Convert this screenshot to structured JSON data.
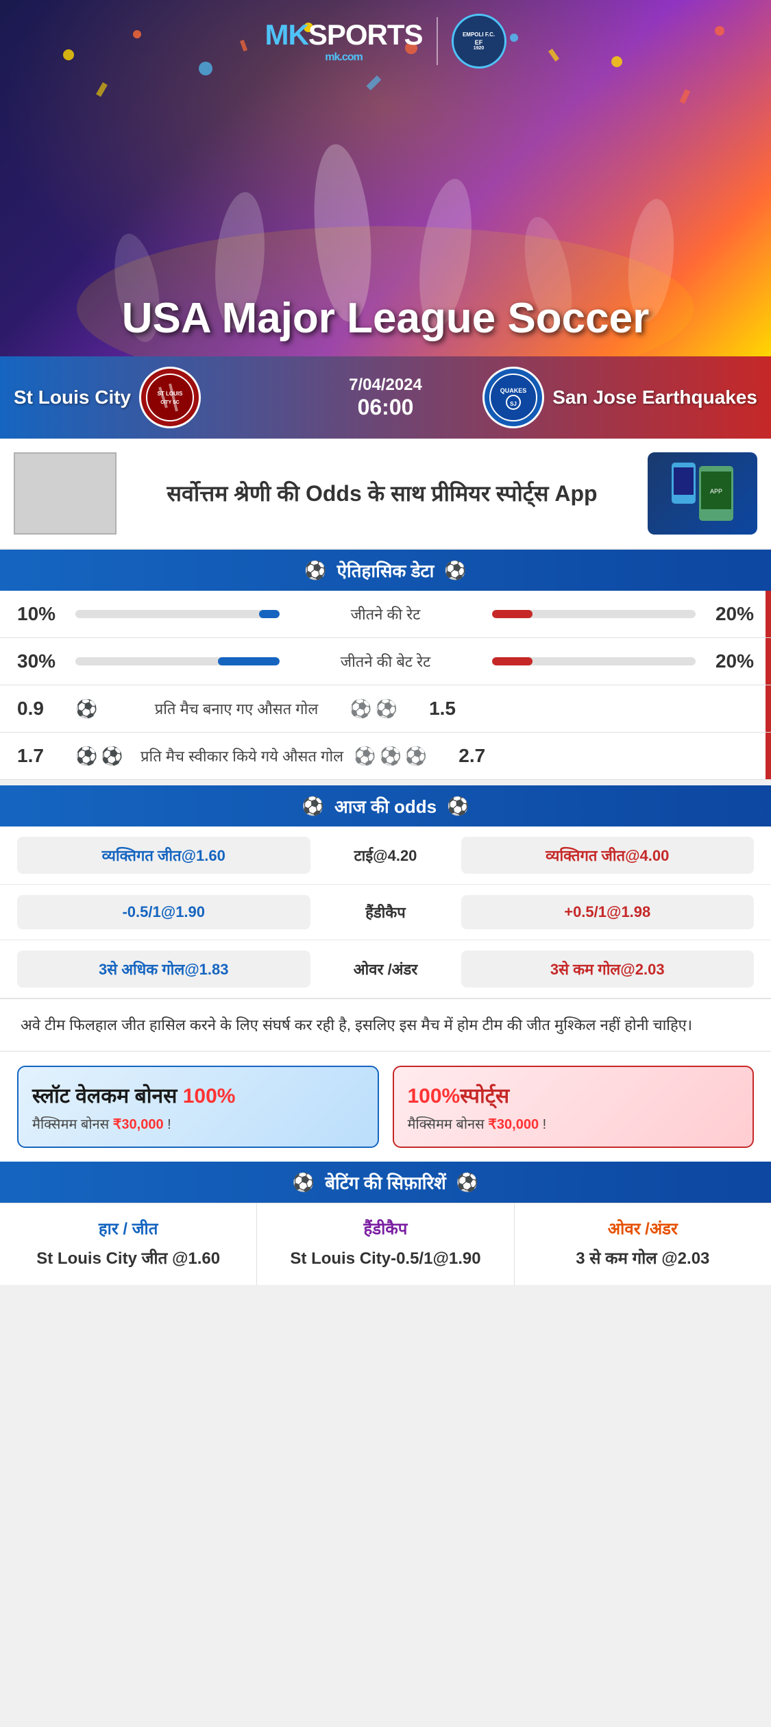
{
  "brand": {
    "name_mk": "MK",
    "name_sports": "SPORTS",
    "tagline": "mk.com",
    "partner_badge": "EMPOLI F.C.",
    "partner_year": "1920"
  },
  "hero": {
    "title": "USA Major League Soccer"
  },
  "match": {
    "home_team": "St Louis City",
    "away_team": "San Jose Earthquakes",
    "away_team_short": "QUAKES",
    "date": "7/04/2024",
    "time": "06:00"
  },
  "ad": {
    "text": "सर्वोत्तम श्रेणी की Odds के साथ प्रीमियर स्पोर्ट्स App"
  },
  "historical": {
    "section_title": "ऐतिहासिक डेटा",
    "stats": [
      {
        "label": "जीतने की रेट",
        "left_value": "10%",
        "right_value": "20%",
        "left_pct": 10,
        "right_pct": 20
      },
      {
        "label": "जीतने की बेट रेट",
        "left_value": "30%",
        "right_value": "20%",
        "left_pct": 30,
        "right_pct": 20
      },
      {
        "label": "प्रति मैच बनाए गए औसत गोल",
        "left_value": "0.9",
        "right_value": "1.5",
        "left_balls": 1,
        "right_balls": 2
      },
      {
        "label": "प्रति मैच स्वीकार किये गये औसत गोल",
        "left_value": "1.7",
        "right_value": "2.7",
        "left_balls": 2,
        "right_balls": 3
      }
    ]
  },
  "odds": {
    "section_title": "आज की odds",
    "rows": [
      {
        "left_label": "व्यक्तिगत जीत@1.60",
        "center_label": "टाई@4.20",
        "right_label": "व्यक्तिगत जीत@4.00",
        "type": "win_tie_win"
      },
      {
        "left_label": "-0.5/1@1.90",
        "center_label": "हैंडीकैप",
        "right_label": "+0.5/1@1.98",
        "type": "handicap"
      },
      {
        "left_label": "3से अधिक गोल@1.83",
        "center_label": "ओवर /अंडर",
        "right_label": "3से कम गोल@2.03",
        "type": "over_under"
      }
    ]
  },
  "comment": "अवे टीम फिलहाल जीत हासिल करने के लिए संघर्ष कर रही है, इसलिए इस मैच में होम टीम की जीत मुश्किल नहीं होनी चाहिए।",
  "bonus": {
    "card1_title": "स्लॉट वेलकम बोनस 100%",
    "card1_sub": "मैक्सिमम बोनस ₹30,000  !",
    "card2_title": "100%स्पोर्ट्स",
    "card2_sub": "मैक्सिमम बोनस  ₹30,000 !"
  },
  "recommendations": {
    "section_title": "बेटिंग की सिफ़ारिशें",
    "cols": [
      {
        "category": "हार / जीत",
        "value": "St Louis City जीत @1.60"
      },
      {
        "category": "हैंडीकैप",
        "value": "St Louis City-0.5/1@1.90"
      },
      {
        "category": "ओवर /अंडर",
        "value": "3 से कम गोल @2.03"
      }
    ]
  }
}
